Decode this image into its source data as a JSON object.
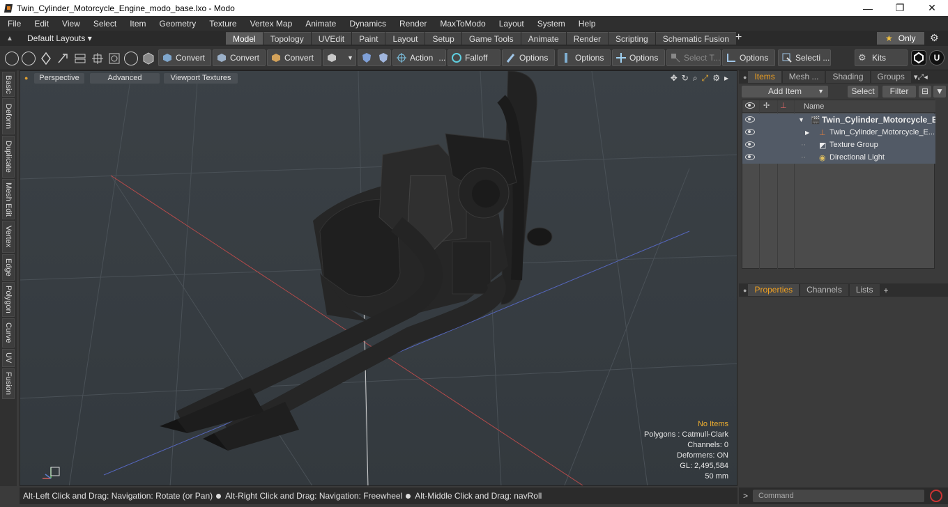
{
  "window": {
    "title": "Twin_Cylinder_Motorcycle_Engine_modo_base.lxo - Modo",
    "minimize": "—",
    "maximize": "❐",
    "close": "✕"
  },
  "menu": [
    "File",
    "Edit",
    "View",
    "Select",
    "Item",
    "Geometry",
    "Texture",
    "Vertex Map",
    "Animate",
    "Dynamics",
    "Render",
    "MaxToModo",
    "Layout",
    "System",
    "Help"
  ],
  "layouts_label": "Default Layouts ▾",
  "tabs": [
    "Model",
    "Topology",
    "UVEdit",
    "Paint",
    "Layout",
    "Setup",
    "Game Tools",
    "Animate",
    "Render",
    "Scripting",
    "Schematic Fusion"
  ],
  "active_tab": "Model",
  "only_label": "Only",
  "toolbar": {
    "convert1": "Convert",
    "convert2": "Convert",
    "convert3": "Convert",
    "action": "Action",
    "action_more": "...",
    "falloff": "Falloff",
    "options1": "Options",
    "options2": "Options",
    "options3": "Options",
    "select_t": "Select T...",
    "options4": "Options",
    "selecti": "Selecti ...",
    "kits": "Kits"
  },
  "left_tabs": [
    "Basic",
    "Deform",
    "Duplicate",
    "Mesh Edit",
    "Vertex",
    "Edge",
    "Polygon",
    "Curve",
    "UV",
    "Fusion"
  ],
  "viewport": {
    "perspective": "Perspective",
    "advanced": "Advanced",
    "textures": "Viewport Textures",
    "stats": {
      "no_items": "No Items",
      "polygons": "Polygons : Catmull-Clark",
      "channels": "Channels: 0",
      "deformers": "Deformers: ON",
      "gl": "GL: 2,495,584",
      "mm": "50 mm"
    }
  },
  "status": {
    "part1": "Alt-Left Click and Drag: Navigation: Rotate (or Pan)",
    "part2": "Alt-Right Click and Drag: Navigation: Freewheel",
    "part3": "Alt-Middle Click and Drag: navRoll"
  },
  "command_placeholder": "Command",
  "items_panel": {
    "tabs": [
      "Items",
      "Mesh ...",
      "Shading",
      "Groups"
    ],
    "add_item": "Add Item",
    "select": "Select",
    "filter": "Filter",
    "name_header": "Name",
    "rows": [
      {
        "label": "Twin_Cylinder_Motorcycle_E..."
      },
      {
        "label": "Twin_Cylinder_Motorcycle_E..."
      },
      {
        "label": "Texture Group"
      },
      {
        "label": "Directional Light"
      }
    ]
  },
  "props_panel": {
    "tabs": [
      "Properties",
      "Channels",
      "Lists"
    ],
    "plus": "+"
  }
}
